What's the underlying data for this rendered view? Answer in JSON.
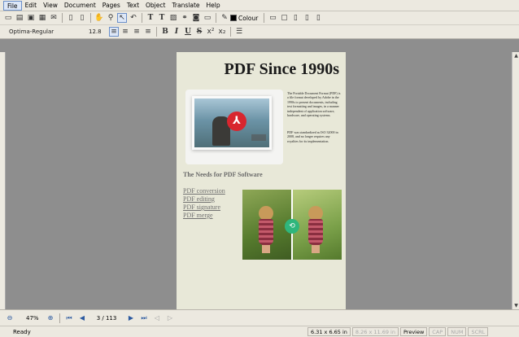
{
  "menu": {
    "items": [
      "File",
      "Edit",
      "View",
      "Document",
      "Pages",
      "Text",
      "Object",
      "Translate",
      "Help"
    ]
  },
  "toolbar": {
    "colour_label": "Colour",
    "icons": [
      "new-icon",
      "open-icon",
      "save-icon",
      "print-icon",
      "email-icon",
      "page-icon",
      "copy-page-icon",
      "hand-icon",
      "zoom-icon",
      "select-icon",
      "undo-icon",
      "text-tool-icon",
      "text-tool-icon",
      "image-icon",
      "link-icon",
      "camera-icon",
      "fill-icon",
      "eyedropper-icon"
    ]
  },
  "format_bar": {
    "font": "Optima-Regular",
    "size": "12.8"
  },
  "document": {
    "title": "PDF Since 1990s",
    "intro": "The Portable Document Format (PDF) is a file format developed by Adobe in the 1990s to present documents, including text formatting and images, in a manner independent of application software, hardware, and operating systems.",
    "intro2": "PDF was standardized as ISO 32000 in 2008, and no longer requires any royalties for its implementation.",
    "section_title": "The Needs for PDF Software",
    "links": [
      "PDF conversion",
      "PDF editing",
      "PDF signature",
      "PDF merge"
    ]
  },
  "navigation": {
    "zoom": "47%",
    "page": "3 / 113"
  },
  "status": {
    "ready": "Ready",
    "page_size": "6.31 x 6.65 in",
    "cursor_size": "8.26 x 11.69 in",
    "mode": "Preview",
    "cap": "CAP",
    "num": "NUM",
    "scrl": "SCRL"
  },
  "colors": {
    "page_bg": "#e8e8d8",
    "workspace_bg": "#8e8e8e",
    "pdf_red": "#d8262f",
    "badge_green": "#2fb67c"
  }
}
